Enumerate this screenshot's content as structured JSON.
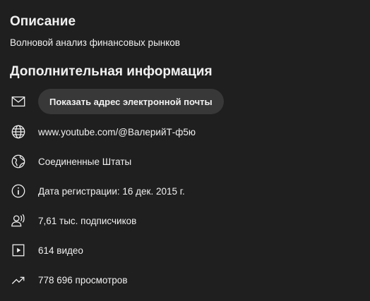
{
  "description": {
    "title": "Описание",
    "text": "Волновой анализ финансовых рынков"
  },
  "info": {
    "title": "Дополнительная информация",
    "email_button": "Показать адрес электронной почты",
    "channel_url": "www.youtube.com/@ВалерийТ-ф5ю",
    "country": "Соединенные Штаты",
    "registered": "Дата регистрации: 16 дек. 2015 г.",
    "subscribers": "7,61 тыс. подписчиков",
    "videos": "614 видео",
    "views": "778 696 просмотров"
  },
  "icons": [
    "mail-icon",
    "globe-icon",
    "earth-icon",
    "info-icon",
    "subscribers-icon",
    "video-icon",
    "trending-icon"
  ],
  "colors": {
    "background": "#1f1f1f",
    "text": "#f1f1f1",
    "button_bg": "#383838"
  }
}
